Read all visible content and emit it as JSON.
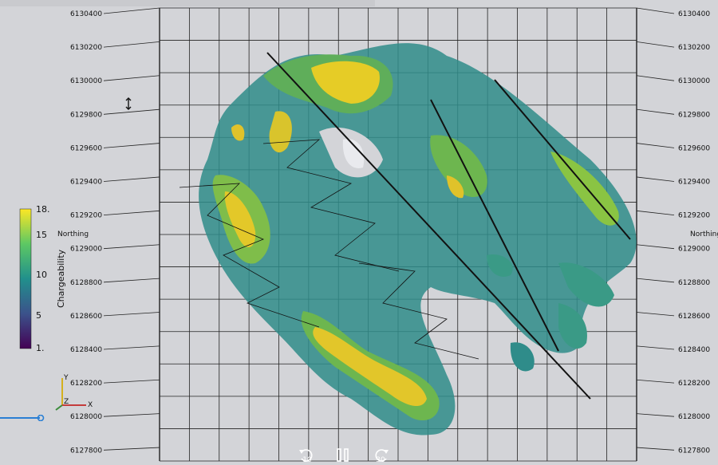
{
  "axes": {
    "left_title": "Northing",
    "right_title": "Northing",
    "northing_ticks": [
      "6130400",
      "6130200",
      "6130000",
      "6129800",
      "6129600",
      "6129400",
      "6129200",
      "6129000",
      "6128800",
      "6128600",
      "6128400",
      "6128200",
      "6128000",
      "6127800"
    ]
  },
  "colorbar": {
    "title": "Chargeability",
    "ticks": [
      "18.",
      "15",
      "10",
      "5",
      "1."
    ],
    "colors": [
      "#440154",
      "#3b528b",
      "#21908c",
      "#5dc863",
      "#fde725"
    ]
  },
  "orientation": {
    "y": "Y",
    "z": "Z",
    "x": "X"
  },
  "playback": {
    "rewind_seconds": "10",
    "forward_seconds": "30"
  },
  "colors": {
    "background": "#d3d4d8",
    "grid": "#222222",
    "scrubber": "#2a7fd4"
  }
}
